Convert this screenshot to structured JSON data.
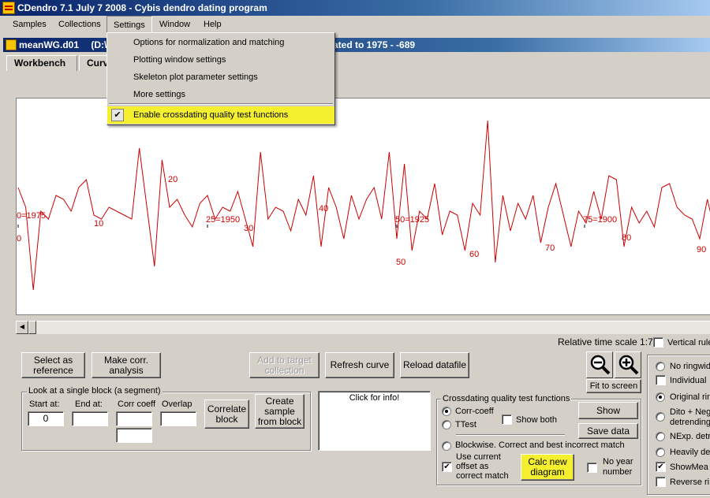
{
  "window": {
    "title": "CDendro 7.1  July 7 2008 - Cybis dendro dating program"
  },
  "menu": {
    "items": [
      "Samples",
      "Collections",
      "Settings",
      "Window",
      "Help"
    ]
  },
  "settings_menu": {
    "items": [
      "Options for normalization and matching",
      "Plotting window settings",
      "Skeleton plot parameter settings",
      "More settings"
    ],
    "checked_item": "Enable crossdating quality test functions",
    "check_glyph": "✔"
  },
  "child": {
    "title_left": "meanWG.d01",
    "title_mid": "(D:\\",
    "title_right": "ated to 1975 - -689"
  },
  "tabs": [
    "Workbench",
    "Curv"
  ],
  "plot": {
    "line_color": "#cc0000",
    "labels": [
      "0=1975",
      "10",
      "20",
      "25=1950",
      "30",
      "40",
      "50=1925",
      "50",
      "60",
      "70",
      "75=1900",
      "80",
      "90",
      "0"
    ]
  },
  "chart_data": {
    "type": "line",
    "title": "",
    "xlabel": "",
    "ylabel": "",
    "x": [
      0,
      1,
      2,
      3,
      4,
      5,
      6,
      7,
      8,
      9,
      10,
      11,
      12,
      13,
      14,
      15,
      16,
      17,
      18,
      19,
      20,
      21,
      22,
      23,
      24,
      25,
      26,
      27,
      28,
      29,
      30,
      31,
      32,
      33,
      34,
      35,
      36,
      37,
      38,
      39,
      40,
      41,
      42,
      43,
      44,
      45,
      46,
      47,
      48,
      49,
      50,
      51,
      52,
      53,
      54,
      55,
      56,
      57,
      58,
      59,
      60,
      61,
      62,
      63,
      64,
      65,
      66,
      67,
      68,
      69,
      70,
      71,
      72,
      73,
      74,
      75,
      76,
      77,
      78,
      79,
      80,
      81,
      82,
      83,
      84,
      85,
      86,
      87,
      88,
      89,
      90,
      91,
      92
    ],
    "values": [
      0.45,
      0.2,
      -0.85,
      0.15,
      0.05,
      0.35,
      0.3,
      0.15,
      0.45,
      0.55,
      0.1,
      0.05,
      0.2,
      0.15,
      0.1,
      0.05,
      0.95,
      0.2,
      -0.55,
      0.8,
      0.2,
      0.3,
      0.1,
      -0.05,
      0.25,
      0.35,
      0.05,
      0.2,
      0.15,
      0.4,
      0.05,
      -0.3,
      0.9,
      0.05,
      0.2,
      0.15,
      -0.1,
      0.3,
      0.1,
      0.6,
      -0.3,
      0.45,
      0.2,
      -0.2,
      0.35,
      0.05,
      0.3,
      0.45,
      0.05,
      0.9,
      -0.2,
      0.75,
      -0.35,
      0.15,
      0.05,
      0.5,
      -0.15,
      0.15,
      0.1,
      -0.35,
      0.25,
      0.1,
      1.3,
      -0.5,
      0.35,
      -0.1,
      0.25,
      0.05,
      0.35,
      -0.25,
      0.2,
      0.5,
      0.1,
      -0.3,
      0.15,
      0.0,
      0.4,
      0.05,
      0.6,
      0.55,
      -0.3,
      0.2,
      0.0,
      0.15,
      -0.05,
      0.45,
      0.5,
      0.2,
      0.1,
      0.05,
      -0.2,
      0.3,
      -0.1
    ]
  },
  "scale": {
    "text": "Relative time scale 1:7"
  },
  "buttons": {
    "select_ref": "Select as reference",
    "make_corr": "Make corr. analysis",
    "add_target": "Add to target collection",
    "refresh": "Refresh curve",
    "reload": "Reload datafile",
    "fit": "Fit to screen",
    "correlate": "Correlate block",
    "create_sample": "Create sample from block",
    "show": "Show",
    "save": "Save data",
    "calc": "Calc new diagram"
  },
  "block": {
    "title": "Look at a single block (a segment)",
    "start_label": "Start at:",
    "start_value": "0",
    "end_label": "End at:",
    "end_value": "",
    "corr_label": "Corr coeff",
    "corr_value": "",
    "corr_value2": "",
    "overlap_label": "Overlap",
    "overlap_value": ""
  },
  "info": {
    "text": "Click for info!"
  },
  "quality": {
    "title": "Crossdating quality test functions",
    "corr_coeff": "Corr-coeff",
    "ttest": "TTest",
    "show_both": "Show both",
    "blockwise": "Blockwise. Correct and best incorrect match",
    "use_offset": "Use current offset as correct match",
    "no_year": "No year number"
  },
  "right": {
    "vertical": "Vertical rule",
    "options": [
      "No ringwid",
      "Individual",
      "Original rin",
      "Dito + Neg detrending",
      "NExp. detr",
      "Heavily de",
      "ShowMea",
      "Reverse ri"
    ]
  }
}
